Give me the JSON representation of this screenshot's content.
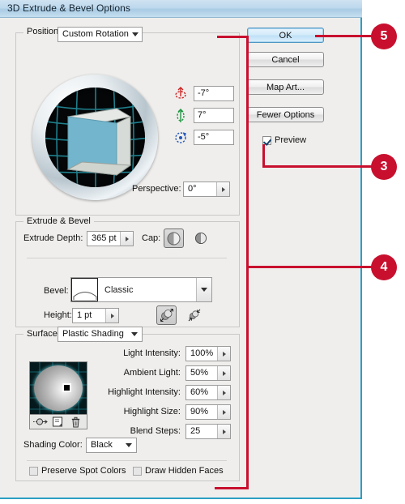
{
  "window": {
    "title": "3D Extrude & Bevel Options"
  },
  "position_section": {
    "label": "Position:",
    "value": "Custom Rotation",
    "rotation": {
      "x_axis": {
        "icon": "rotate-x-icon",
        "value": "-7°",
        "color": "#cc2222"
      },
      "y_axis": {
        "icon": "rotate-y-icon",
        "value": "7°",
        "color": "#229944"
      },
      "z_axis": {
        "icon": "rotate-z-icon",
        "value": "-5°",
        "color": "#2255bb"
      }
    },
    "perspective": {
      "label": "Perspective:",
      "value": "0°"
    }
  },
  "buttons": {
    "ok": "OK",
    "cancel": "Cancel",
    "map_art": "Map Art...",
    "fewer_options": "Fewer Options"
  },
  "preview": {
    "label": "Preview",
    "checked": true
  },
  "extrude_bevel": {
    "legend": "Extrude & Bevel",
    "extrude_depth": {
      "label": "Extrude Depth:",
      "value": "365 pt"
    },
    "cap": {
      "label": "Cap:",
      "options": [
        "cap-solid-icon",
        "cap-hollow-icon"
      ],
      "selected": 0
    },
    "bevel": {
      "label": "Bevel:",
      "value": "Classic",
      "swatch": "bevel-classic-icon"
    },
    "height": {
      "label": "Height:",
      "value": "1 pt"
    },
    "bevel_extent": {
      "out_icon": "bevel-extent-out-icon",
      "in_icon": "bevel-extent-in-icon",
      "selected": 0
    }
  },
  "surface": {
    "legend": "Surface:",
    "value": "Plastic Shading",
    "preview_icons": [
      "move-light-icon",
      "new-light-icon",
      "delete-light-icon"
    ],
    "fields": [
      {
        "label": "Light Intensity:",
        "value": "100%"
      },
      {
        "label": "Ambient Light:",
        "value": "50%"
      },
      {
        "label": "Highlight Intensity:",
        "value": "60%"
      },
      {
        "label": "Highlight Size:",
        "value": "90%"
      },
      {
        "label": "Blend Steps:",
        "value": "25"
      }
    ],
    "shading_color": {
      "label": "Shading Color:",
      "value": "Black"
    },
    "preserve_spot_colors": {
      "label": "Preserve Spot Colors",
      "checked": false
    },
    "draw_hidden_faces": {
      "label": "Draw Hidden Faces",
      "checked": false
    }
  },
  "callouts": [
    {
      "number": "5"
    },
    {
      "number": "3"
    },
    {
      "number": "4"
    }
  ],
  "colors": {
    "callout": "#c8102e",
    "titlebar": "#bed8ed",
    "dialog_border": "#2a9fc4"
  }
}
